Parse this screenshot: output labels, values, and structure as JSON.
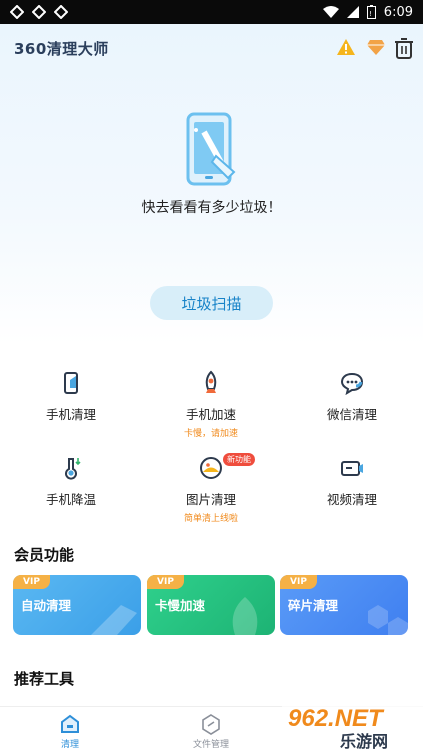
{
  "status_bar": {
    "time": "6:09"
  },
  "header": {
    "app_title": "360清理大师"
  },
  "hero": {
    "message": "快去看看有多少垃圾！",
    "scan_button": "垃圾扫描"
  },
  "tools": [
    {
      "label": "手机清理",
      "sub": ""
    },
    {
      "label": "手机加速",
      "sub": "卡慢，请加速"
    },
    {
      "label": "微信清理",
      "sub": ""
    },
    {
      "label": "手机降温",
      "sub": ""
    },
    {
      "label": "图片清理",
      "sub": "简单清上线啦",
      "badge": "新功能"
    },
    {
      "label": "视频清理",
      "sub": ""
    }
  ],
  "member": {
    "title": "会员功能",
    "cards": [
      {
        "tag": "VIP",
        "label": "自动清理",
        "color": "#3ea7f0"
      },
      {
        "tag": "VIP",
        "label": "卡慢加速",
        "color": "#23c27e"
      },
      {
        "tag": "VIP",
        "label": "碎片清理",
        "color": "#4c8ef5"
      }
    ]
  },
  "recommend": {
    "title": "推荐工具"
  },
  "bottom_nav": {
    "items": [
      {
        "label": "清理"
      },
      {
        "label": "文件管理"
      }
    ]
  },
  "watermark": {
    "text1": "962.NET",
    "text2": "乐游网"
  }
}
